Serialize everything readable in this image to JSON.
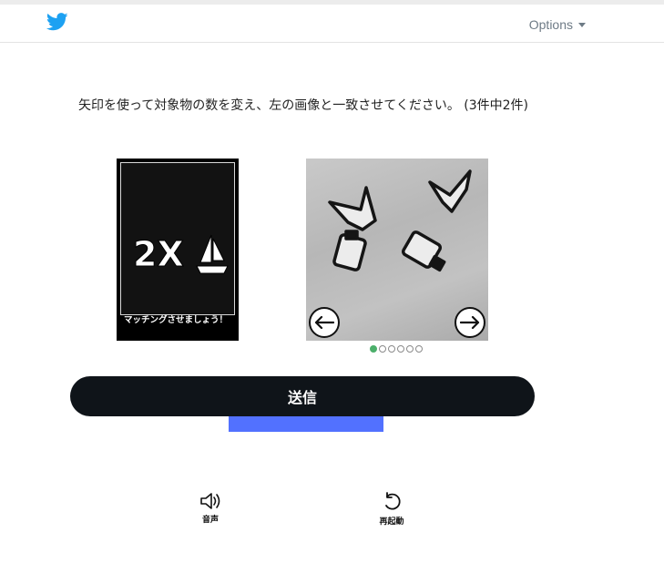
{
  "header": {
    "logo": "twitter-bird-icon",
    "options_label": "Options",
    "brand_color": "#1da1f2"
  },
  "challenge": {
    "instruction": "矢印を使って対象物の数を変え、左の画像と一致させてください。 (3件中2件)",
    "target": {
      "count_text": "2X",
      "object_icon": "sailboat-icon",
      "caption": "マッチングさせましょう！"
    },
    "carousel": {
      "prev_icon": "arrow-left-icon",
      "next_icon": "arrow-right-icon",
      "total_dots": 6,
      "active_dot": 1
    },
    "submit_label": "送信"
  },
  "tools": {
    "audio_label": "音声",
    "restart_label": "再起動"
  },
  "colors": {
    "submit_bg": "#0f1419",
    "accent_bar": "#5271ff",
    "active_dot": "#4caf6b"
  }
}
